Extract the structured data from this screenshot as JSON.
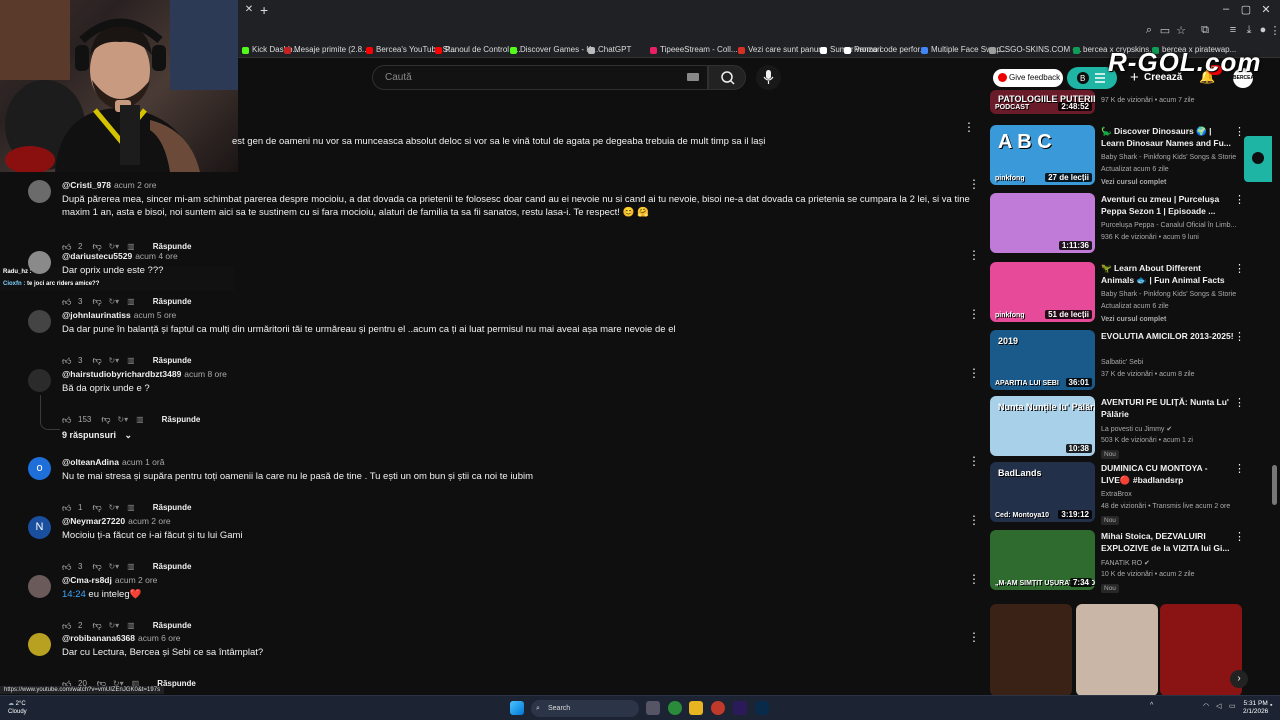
{
  "browser": {
    "bookmarks": [
      {
        "label": "Kick Dashb...",
        "color": "#53fc18"
      },
      {
        "label": "Mesaje primite (2.8...",
        "color": "#c5221f"
      },
      {
        "label": "Bercea's YouTube St...",
        "color": "#ff0000"
      },
      {
        "label": "Panoul de Control -...",
        "color": "#ff0000"
      },
      {
        "label": "Discover Games - K...",
        "color": "#53fc18"
      },
      {
        "label": "ChatGPT",
        "color": "#bbbbbb"
      },
      {
        "label": "TipeeeStream - Coll...",
        "color": "#e91e63"
      },
      {
        "label": "Vezi care sunt panur...",
        "color": "#d93025"
      },
      {
        "label": "Sumar vanzari",
        "color": "#ffffff"
      },
      {
        "label": "Promo code perfor...",
        "color": "#ffffff"
      },
      {
        "label": "Multiple Face Swap...",
        "color": "#4285f4"
      },
      {
        "label": "CSGO-SKINS.COM -...",
        "color": "#9e9e9e"
      },
      {
        "label": "bercea x crypskins...",
        "color": "#0f9d58"
      },
      {
        "label": "bercea x piratewap...",
        "color": "#0f9d58"
      }
    ],
    "status_url": "https://www.youtube.com/watch?v=vmUIZEnJGK0&t=197s"
  },
  "header": {
    "search_placeholder": "Caută",
    "feedback_label": "Give feedback",
    "create_label": "Creează",
    "notif_count": "9+",
    "avatar_text": "BERCEA",
    "watermark": "R-GOL.com"
  },
  "top_fragment": "est gen de  oameni nu vor sa munceasca absolut deloc si vor sa le vină totul de agata pe degeaba trebuia de mult timp sa il lași",
  "comments": [
    {
      "author": "@Cristi_978",
      "time": "acum 2 ore",
      "text": "După părerea mea, sincer mi-am schimbat parerea despre mocioiu, a dat dovada ca prietenii te folosesc doar cand au ei nevoie nu si cand ai tu nevoie, bisoi ne-a dat dovada ca prietenia se cumpara la 2 lei, si va tine maxim 1 an, asta e bisoi, noi suntem aici sa te sustinem cu si fara mocioiu, alaturi de familia ta sa fii sanatos, restu lasa-i. Te respect! 😊 🤗",
      "likes": "2",
      "reply": "Răspunde",
      "avatar_letter": "",
      "avatar_color": "#6b6b6b"
    },
    {
      "author": "@dariustecu5529",
      "time": "acum 4 ore",
      "text": "Dar oprix unde este ???",
      "likes": "3",
      "reply": "Răspunde",
      "avatar_letter": "",
      "avatar_color": "#8a8a8a"
    },
    {
      "author": "@johnlaurinatiss",
      "time": "acum 5 ore",
      "text": "Da dar pune în balanță și faptul ca mulți din urmăritorii tăi te urmăreau și pentru el ..acum ca ți  ai luat permisul nu mai aveai așa mare nevoie de el",
      "likes": "3",
      "reply": "Răspunde",
      "avatar_letter": "",
      "avatar_color": "#444444"
    },
    {
      "author": "@hairstudiobyrichardbzt3489",
      "time": "acum 8 ore",
      "text": "Bă da oprix unde e ?",
      "likes": "153",
      "reply": "Răspunde",
      "avatar_letter": "",
      "avatar_color": "#2b2b2b"
    },
    {
      "author": "@olteanAdina",
      "time": "acum 1 oră",
      "text": "Nu te mai stresa și supăra pentru toți oamenii la care nu le pasă de tine . Tu ești un om bun și știi ca noi te iubim",
      "likes": "1",
      "reply": "Răspunde",
      "avatar_letter": "o",
      "avatar_color": "#1e6fd9"
    },
    {
      "author": "@Neymar27220",
      "time": "acum 2 ore",
      "text": "Mocioiu ți-a făcut ce i-ai făcut și tu lui Gami",
      "likes": "3",
      "reply": "Răspunde",
      "avatar_letter": "N",
      "avatar_color": "#1a4e9e"
    },
    {
      "author": "@Cma-rs8dj",
      "time": "acum 2 ore",
      "text_link": "14:24",
      "text": " eu inteleg❤️",
      "likes": "2",
      "reply": "Răspunde",
      "avatar_letter": "",
      "avatar_color": "#6a5a5a"
    },
    {
      "author": "@robibanana6368",
      "time": "acum 6 ore",
      "text": "Dar cu Lectura, Bercea și Sebi ce sa întâmplat?",
      "likes": "20",
      "reply": "Răspunde",
      "avatar_letter": "",
      "avatar_color": "#b8a020"
    }
  ],
  "replies_label": "9 răspunsuri",
  "chat": [
    {
      "user": "Radu_hz :",
      "msg": "",
      "color": "#ffffff"
    },
    {
      "user": "Cioxfn :",
      "msg": "te joci arc riders amice??",
      "color": "#7dd3fc"
    }
  ],
  "sidebar": [
    {
      "title": "",
      "channel": "",
      "meta": "97 K de vizionări • acum 7 zile",
      "duration": "2:48:52",
      "thumb_text": "PATOLOGIILE PUTERII",
      "thumb_sub": "PODCAST",
      "bg": "#6a1b2a",
      "new": ""
    },
    {
      "title": "🦕 Discover Dinosaurs 🌍 | Learn Dinosaur Names and Fu...",
      "channel": "Baby Shark - Pinkfong Kids' Songs & Storie",
      "meta": "Actualizat acum 6 zile",
      "duration": "27 de lecții",
      "thumb_text": "A B C",
      "thumb_sub": "pinkfong",
      "bg": "#3a9ad9",
      "new": "",
      "more": "Vezi cursul complet"
    },
    {
      "title": "Aventuri cu zmeu | Purceluşa Peppa Sezon 1 | Episoade ...",
      "channel": "Purceluşa Peppa - Canalul Oficial în Limb...",
      "meta": "936 K de vizionări • acum 9 luni",
      "duration": "1:11:36",
      "thumb_text": "",
      "thumb_sub": "",
      "bg": "#c07ad8",
      "new": ""
    },
    {
      "title": "🦖 Learn About Different Animals 🐟 | Fun Animal Facts",
      "channel": "Baby Shark - Pinkfong Kids' Songs & Storie",
      "meta": "Actualizat acum 6 zile",
      "duration": "51 de lecții",
      "thumb_text": "",
      "thumb_sub": "pinkfong",
      "bg": "#e84a9a",
      "new": "",
      "more": "Vezi cursul complet"
    },
    {
      "title": "EVOLUTIA AMICILOR 2013-2025!",
      "channel": "Salbatic' Sebi",
      "meta": "37 K de vizionări • acum 8 zile",
      "duration": "36:01",
      "thumb_text": "2019",
      "thumb_sub": "APARITIA LUI SEBI",
      "bg": "#1a5a8a",
      "new": ""
    },
    {
      "title": "AVENTURI PE ULIȚĂ: Nunta Lu' Pălărie",
      "channel": "La povesti cu Jimmy ✔",
      "meta": "503 K de vizionări • acum 1 zi",
      "duration": "10:38",
      "thumb_text": "Nunta Nunțile lu' Pălărie",
      "thumb_sub": "",
      "bg": "#a8d0e8",
      "new": "Nou"
    },
    {
      "title": "DUMINICA CU MONTOYA - LIVE🔴 #badlandsrp",
      "channel": "ExtraBrox",
      "meta": "48 de vizionări • Transmis live acum 2 ore",
      "duration": "3:19:12",
      "thumb_text": "BadLands",
      "thumb_sub": "Ced: Montoya10",
      "bg": "#22304a",
      "new": "Nou"
    },
    {
      "title": "Mihai Stoica, DEZVALUIRI EXPLOZIVE de la VIZITA lui Gi...",
      "channel": "FANATIK RO ✔",
      "meta": "10 K de vizionări • acum 2 zile",
      "duration": "7:34",
      "thumb_text": "",
      "thumb_sub": "„M-AM SIMȚIT UȘURAT CÂND A...",
      "bg": "#2f6b2f",
      "new": "Nou"
    }
  ],
  "taskbar": {
    "weather_temp": "2°C",
    "weather_desc": "Cloudy",
    "search_label": "Search",
    "time": "5:31 PM",
    "date": "2/1/2026"
  }
}
